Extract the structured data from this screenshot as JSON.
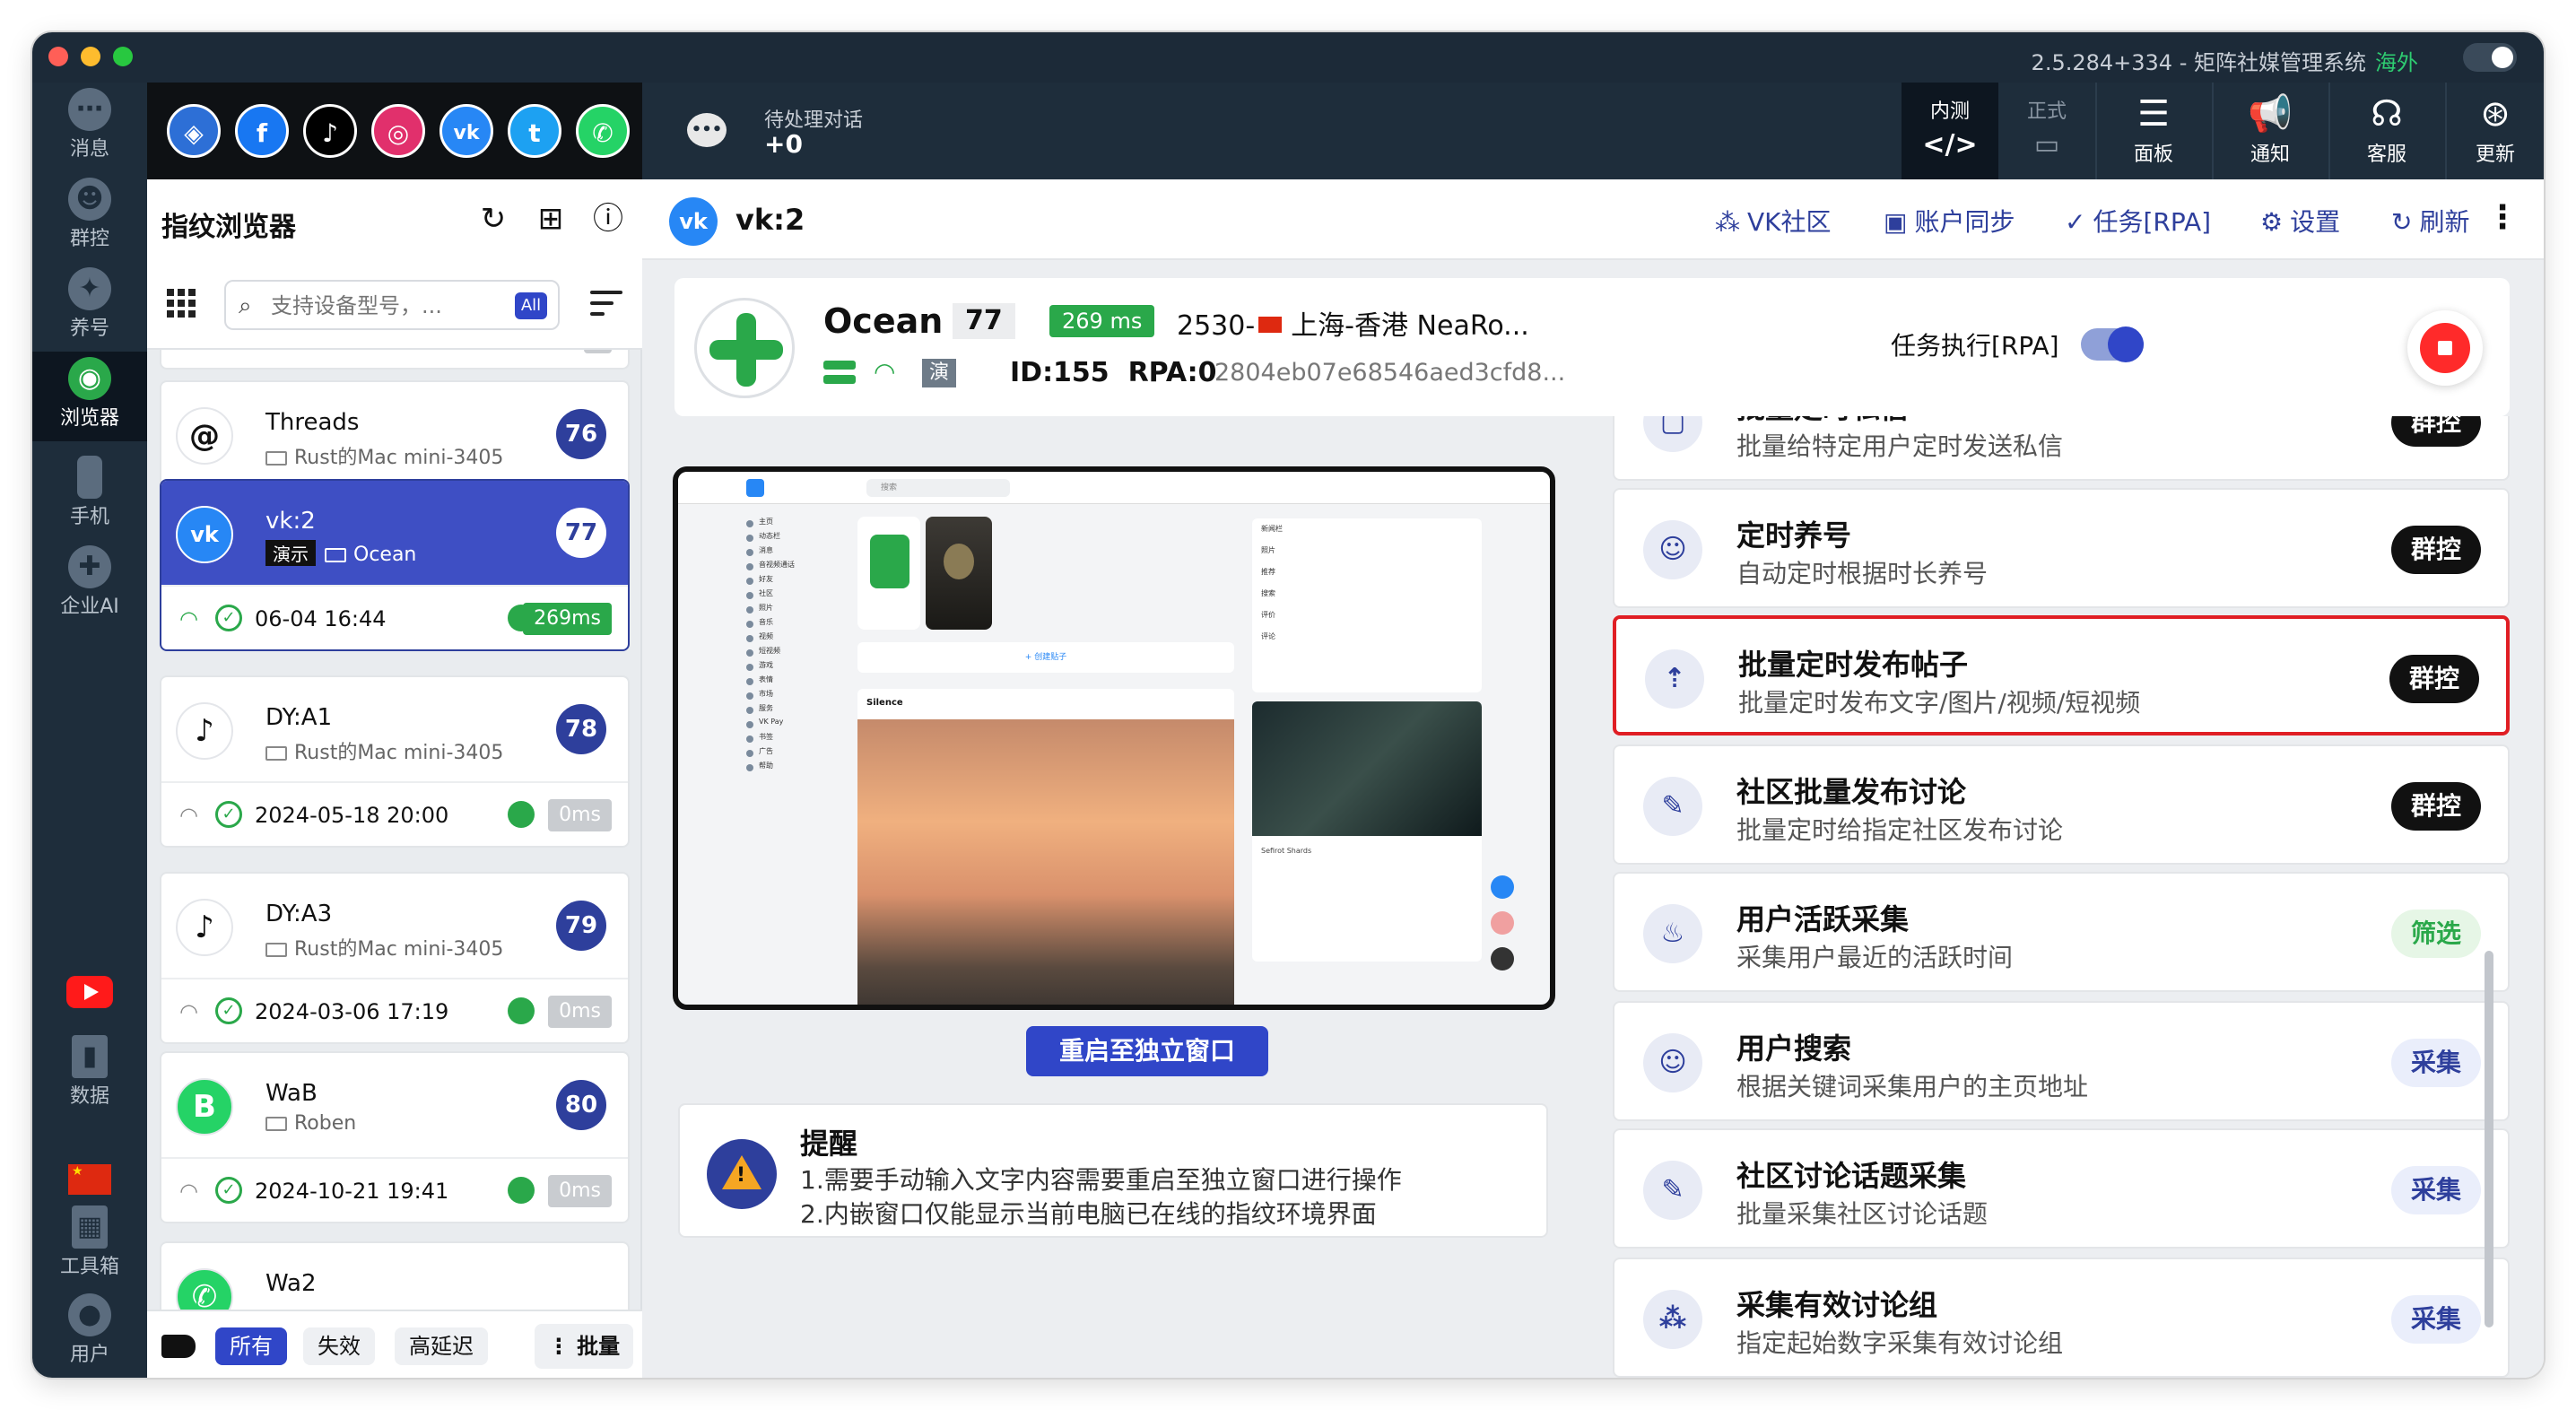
{
  "window": {
    "title": "2.5.284+334 - 矩阵社媒管理系统",
    "title_tag": "海外"
  },
  "rail": {
    "items": [
      {
        "label": "消息",
        "icon": "chat-icon"
      },
      {
        "label": "群控",
        "icon": "group-control-icon"
      },
      {
        "label": "养号",
        "icon": "account-nurture-icon"
      },
      {
        "label": "浏览器",
        "icon": "browser-icon"
      },
      {
        "label": "手机",
        "icon": "phone-icon"
      },
      {
        "label": "企业AI",
        "icon": "ai-icon"
      },
      {
        "label": "数据",
        "icon": "data-icon"
      },
      {
        "label": "工具箱",
        "icon": "toolbox-icon"
      },
      {
        "label": "用户",
        "icon": "user-icon"
      }
    ]
  },
  "social_apps": [
    "browser",
    "facebook",
    "tiktok",
    "instagram",
    "vk",
    "twitter",
    "whatsapp"
  ],
  "topbar": {
    "pending_title": "待处理对话",
    "pending_count": "+0",
    "mode_test": "内测",
    "mode_prod": "正式",
    "buttons": [
      "面板",
      "通知",
      "客服",
      "更新"
    ]
  },
  "list_panel": {
    "title": "指纹浏览器",
    "search_placeholder": "支持设备型号，...",
    "all_badge": "All",
    "cards": [
      {
        "name": "Threads",
        "device": "Rust的Mac mini-3405",
        "num": "76",
        "time": "--",
        "ms": "",
        "app": "threads"
      },
      {
        "name": "vk:2",
        "demo": "演示",
        "device": "Ocean",
        "num": "77",
        "time": "06-04 16:44",
        "ms": "269ms",
        "app": "vk"
      },
      {
        "name": "DY:A1",
        "device": "Rust的Mac mini-3405",
        "num": "78",
        "time": "2024-05-18 20:00",
        "ms": "0ms",
        "app": "tiktok"
      },
      {
        "name": "DY:A3",
        "device": "Rust的Mac mini-3405",
        "num": "79",
        "time": "2024-03-06 17:19",
        "ms": "0ms",
        "app": "tiktok"
      },
      {
        "name": "WaB",
        "device": "Roben",
        "num": "80",
        "time": "2024-10-21 19:41",
        "ms": "0ms",
        "app": "whatsapp"
      },
      {
        "name": "Wa2",
        "device": "",
        "num": "",
        "time": "",
        "ms": "",
        "app": "whatsapp"
      }
    ],
    "filters": {
      "all": "所有",
      "invalid": "失效",
      "high_latency": "高延迟",
      "batch": "批量"
    }
  },
  "main": {
    "title": "vk:2",
    "actions": [
      "VK社区",
      "账户同步",
      "任务[RPA]",
      "设置",
      "刷新"
    ],
    "profile": {
      "name": "Ocean",
      "num": "77",
      "ms": "269 ms",
      "geo": "2530-",
      "geo_city": "上海-香港 NeaRo...",
      "demo": "演示",
      "id": "ID:155",
      "rpa": "RPA:0",
      "hash": "2804eb07e68546aed3cfd8...",
      "rpa_label": "任务执行[RPA]",
      "rpa_enabled": true
    },
    "preview": {
      "search": "搜索",
      "menu": [
        "主页",
        "动态栏",
        "消息",
        "音视频通话",
        "好友",
        "社区",
        "照片",
        "音乐",
        "视频",
        "短视频",
        "游戏",
        "表情",
        "市场",
        "服务",
        "VK Pay",
        "书签",
        "广告",
        "帮助"
      ],
      "post_author": "Silence",
      "create_post": "+ 创建贴子",
      "side_items": [
        "新闻栏",
        "照片",
        "推荐",
        "搜索",
        "评价",
        "评论"
      ],
      "ad_title": "Sefirot Shards"
    },
    "restart_label": "重启至独立窗口",
    "notice": {
      "title": "提醒",
      "line1": "1.需要手动输入文字内容需要重启至独立窗口进行操作",
      "line2": "2.内嵌窗口仅能显示当前电脑已在线的指纹环境界面"
    },
    "features": [
      {
        "title": "批量定时私信",
        "desc": "批量给特定用户定时发送私信",
        "btn": "群控",
        "style": "black",
        "icon": "message-icon"
      },
      {
        "title": "定时养号",
        "desc": "自动定时根据时长养号",
        "btn": "群控",
        "style": "black",
        "icon": "robot-icon"
      },
      {
        "title": "批量定时发布帖子",
        "desc": "批量定时发布文字/图片/视频/短视频",
        "btn": "群控",
        "style": "black",
        "icon": "upload-icon",
        "highlight": true
      },
      {
        "title": "社区批量发布讨论",
        "desc": "批量定时给指定社区发布讨论",
        "btn": "群控",
        "style": "black",
        "icon": "post-icon"
      },
      {
        "title": "用户活跃采集",
        "desc": "采集用户最近的活跃时间",
        "btn": "筛选",
        "style": "green",
        "icon": "fire-icon"
      },
      {
        "title": "用户搜索",
        "desc": "根据关键词采集用户的主页地址",
        "btn": "采集",
        "style": "blue",
        "icon": "person-icon"
      },
      {
        "title": "社区讨论话题采集",
        "desc": "批量采集社区讨论话题",
        "btn": "采集",
        "style": "blue",
        "icon": "topic-icon"
      },
      {
        "title": "采集有效讨论组",
        "desc": "指定起始数字采集有效讨论组",
        "btn": "采集",
        "style": "blue",
        "icon": "group-icon"
      }
    ]
  },
  "colors": {
    "accent": "#3046c8",
    "dark": "#1e2d3b",
    "green": "#2aa84a",
    "highlight": "#e01e24"
  }
}
